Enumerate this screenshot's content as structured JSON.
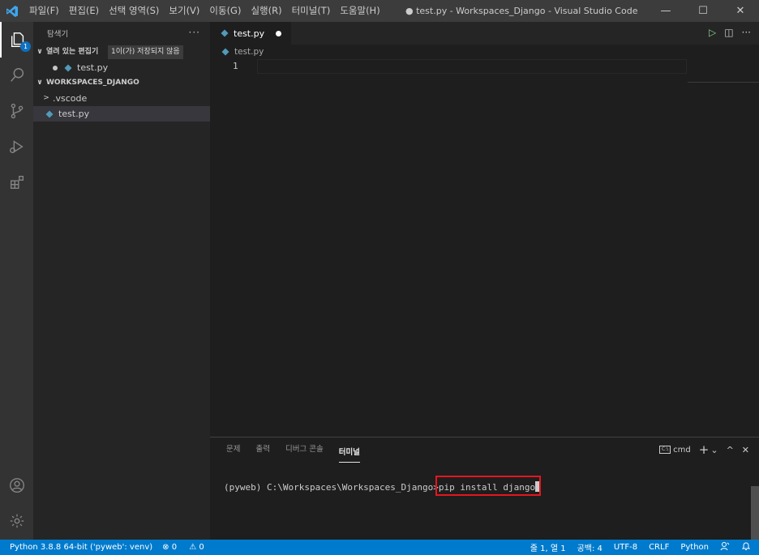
{
  "window": {
    "title": "● test.py - Workspaces_Django - Visual Studio Code",
    "menu": [
      "파일(F)",
      "편집(E)",
      "선택 영역(S)",
      "보기(V)",
      "이동(G)",
      "실행(R)",
      "터미널(T)",
      "도움말(H)"
    ],
    "controls": [
      "—",
      "☐",
      "✕"
    ]
  },
  "activity": {
    "explorer_badge": "1"
  },
  "sidebar": {
    "header": "탐색기",
    "more": "···",
    "open_editors": {
      "label": "열려 있는 편집기",
      "tooltip": "1이(가) 저장되지 않음",
      "files": [
        {
          "name": "test.py"
        }
      ]
    },
    "workspace": {
      "label": "WORKSPACES_DJANGO",
      "items": [
        {
          "name": ".vscode",
          "type": "folder"
        },
        {
          "name": "test.py",
          "type": "file"
        }
      ]
    }
  },
  "editor": {
    "tab": {
      "label": "test.py"
    },
    "breadcrumb": "test.py",
    "line_numbers": [
      "1"
    ],
    "actions": {
      "run": "▷",
      "split": "◫",
      "more": "···"
    }
  },
  "panel": {
    "tabs": [
      {
        "label": "문제",
        "active": false
      },
      {
        "label": "출력",
        "active": false
      },
      {
        "label": "디버그 콘솔",
        "active": false
      },
      {
        "label": "터미널",
        "active": true
      }
    ],
    "terminal_name": "cmd",
    "terminal_icon_text": "C:\\",
    "actions": {
      "add": "+",
      "dropdown": "⌄",
      "maximize": "^",
      "close": "✕"
    },
    "terminal": {
      "prompt": "(pyweb) C:\\Workspaces\\Workspaces_Django>",
      "command": "pip install django"
    }
  },
  "status": {
    "interpreter": "Python 3.8.8 64-bit ('pyweb': venv)",
    "errors": "⊗ 0",
    "warnings": "⚠ 0",
    "position": "줄 1, 열 1",
    "spaces": "공백: 4",
    "encoding": "UTF-8",
    "eol": "CRLF",
    "language": "Python"
  }
}
